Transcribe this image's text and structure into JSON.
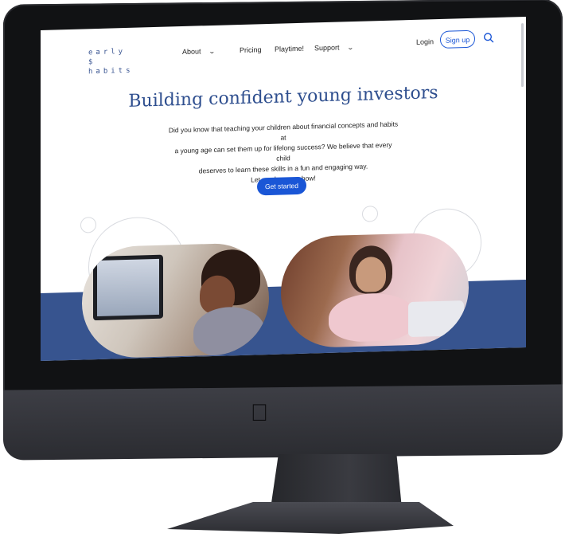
{
  "logo": {
    "line1": "early $",
    "line2": "habits"
  },
  "nav": {
    "about": "About",
    "pricing": "Pricing",
    "playtime": "Playtime!",
    "support": "Support",
    "login": "Login",
    "signup": "Sign up"
  },
  "hero": {
    "title": "Building confident young investors",
    "line1": "Did you know that teaching your children about financial concepts and habits at",
    "line2": "a young age can set them up for lifelong success? We believe that every child",
    "line3": "deserves to learn these skills in a fun and engaging way.",
    "line4": "Let us show you how!",
    "cta": "Get started"
  },
  "colors": {
    "accent": "#1a56d6",
    "brand_navy": "#37548f",
    "title": "#2f4f8f"
  },
  "icons": [
    "search-icon",
    "chevron-down-icon",
    "apple-logo-icon"
  ]
}
